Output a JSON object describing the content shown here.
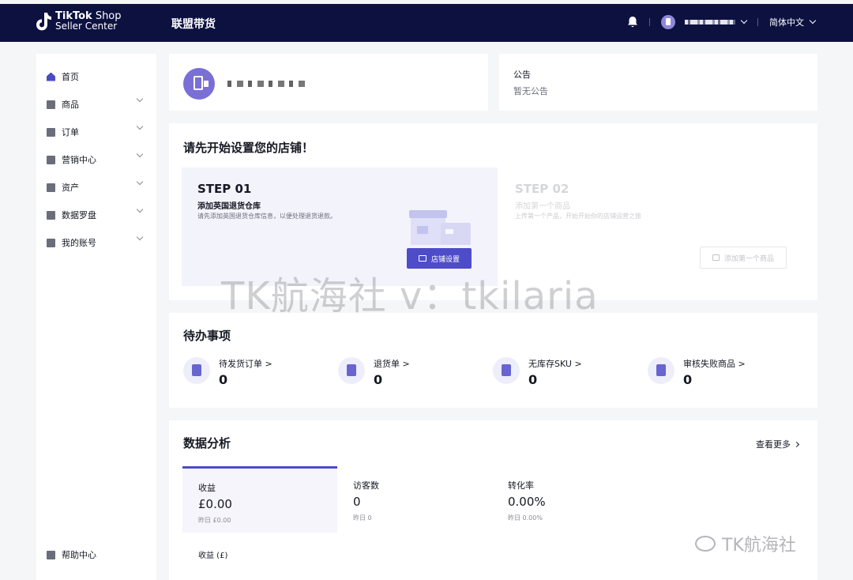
{
  "topbar": {
    "brand_line1": "TikTok",
    "brand_line1_suffix": " Shop",
    "brand_line2": "Seller Center",
    "section_title": "联盟带货",
    "language": "简体中文"
  },
  "sidebar": {
    "items": [
      {
        "label": "首页",
        "icon": "home-icon",
        "active": true
      },
      {
        "label": "商品",
        "icon": "product-icon"
      },
      {
        "label": "订单",
        "icon": "order-icon"
      },
      {
        "label": "营销中心",
        "icon": "megaphone-icon"
      },
      {
        "label": "资产",
        "icon": "wallet-icon"
      },
      {
        "label": "数据罗盘",
        "icon": "chart-icon"
      },
      {
        "label": "我的账号",
        "icon": "user-icon"
      }
    ],
    "help": "帮助中心"
  },
  "notice": {
    "title": "公告",
    "text": "暂无公告"
  },
  "setup": {
    "title": "请先开始设置您的店铺！",
    "step1": {
      "title": "STEP 01",
      "subtitle": "添加英国退货仓库",
      "desc": "请先添加英国退货仓库信息，以便处理退货退款。",
      "button": "店铺设置"
    },
    "step2": {
      "title": "STEP 02",
      "subtitle": "添加第一个商品",
      "desc": "上传第一个产品，开始开始你的店铺运营之旅",
      "button": "添加第一个商品"
    }
  },
  "todo": {
    "title": "待办事项",
    "items": [
      {
        "label": "待发货订单 >",
        "value": "0"
      },
      {
        "label": "退货单 >",
        "value": "0"
      },
      {
        "label": "无库存SKU >",
        "value": "0"
      },
      {
        "label": "审核失败商品 >",
        "value": "0"
      }
    ]
  },
  "analytics": {
    "title": "数据分析",
    "view_more": "查看更多",
    "metrics": [
      {
        "label": "收益",
        "value": "£0.00",
        "sub": "昨日 £0.00",
        "active": true
      },
      {
        "label": "访客数",
        "value": "0",
        "sub": "昨日 0"
      },
      {
        "label": "转化率",
        "value": "0.00%",
        "sub": "昨日 0.00%"
      }
    ],
    "chart_label": "收益 (£)"
  },
  "watermarks": {
    "center": "TK航海社 v：tkilaria",
    "corner": "TK航海社"
  },
  "colors": {
    "topbar": "#0c1140",
    "accent": "#4e4cc9",
    "avatar": "#7a6fd6"
  }
}
